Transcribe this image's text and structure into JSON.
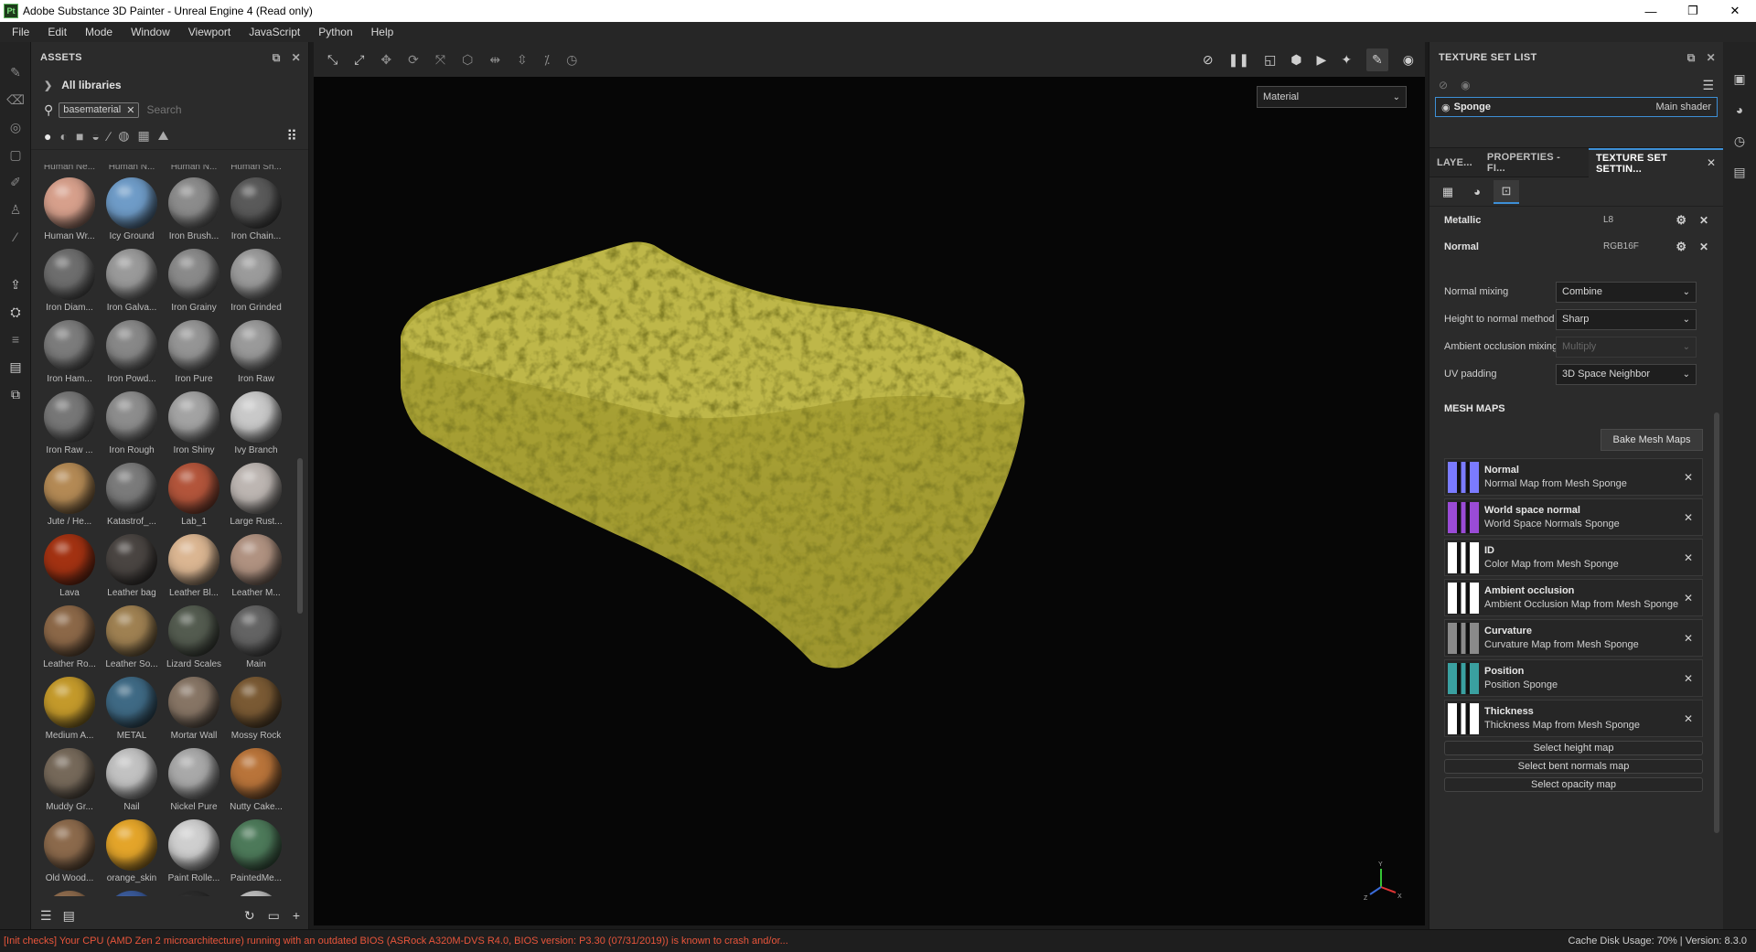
{
  "window": {
    "logo_text": "Pt",
    "title": "Adobe Substance 3D Painter - Unreal Engine 4 (Read only)",
    "minimize": "—",
    "maximize": "❐",
    "close": "✕"
  },
  "menu": [
    "File",
    "Edit",
    "Mode",
    "Window",
    "Viewport",
    "JavaScript",
    "Python",
    "Help"
  ],
  "assets": {
    "title": "ASSETS",
    "libraries_label": "All libraries",
    "search_tag": "basematerial",
    "search_placeholder": "Search",
    "cutoff_labels": [
      "Human Ne...",
      "Human N...",
      "Human N...",
      "Human Sh..."
    ],
    "materials": [
      {
        "label": "Human Wr...",
        "color": "#d7a08c"
      },
      {
        "label": "Icy Ground",
        "color": "#6f9cc8"
      },
      {
        "label": "Iron Brush...",
        "color": "#8c8c8c"
      },
      {
        "label": "Iron Chain...",
        "color": "#5a5a5a"
      },
      {
        "label": "Iron Diam...",
        "color": "#6e6e6e"
      },
      {
        "label": "Iron Galva...",
        "color": "#9a9a9a"
      },
      {
        "label": "Iron Grainy",
        "color": "#8a8a8a"
      },
      {
        "label": "Iron Grinded",
        "color": "#9b9b9b"
      },
      {
        "label": "Iron Ham...",
        "color": "#7c7c7c"
      },
      {
        "label": "Iron Powd...",
        "color": "#888888"
      },
      {
        "label": "Iron Pure",
        "color": "#959595"
      },
      {
        "label": "Iron Raw",
        "color": "#9a9a9a"
      },
      {
        "label": "Iron Raw ...",
        "color": "#777777"
      },
      {
        "label": "Iron Rough",
        "color": "#8d8d8d"
      },
      {
        "label": "Iron Shiny",
        "color": "#a3a3a3"
      },
      {
        "label": "Ivy Branch",
        "color": "#c9c9c9"
      },
      {
        "label": "Jute / He...",
        "color": "#b48a55"
      },
      {
        "label": "Katastrof_...",
        "color": "#7b7b7b"
      },
      {
        "label": "Lab_1",
        "color": "#b3553b"
      },
      {
        "label": "Large Rust...",
        "color": "#bdb6b2"
      },
      {
        "label": "Lava",
        "color": "#a33212"
      },
      {
        "label": "Leather bag",
        "color": "#4a4542"
      },
      {
        "label": "Leather Bl...",
        "color": "#dbb692"
      },
      {
        "label": "Leather M...",
        "color": "#b09281"
      },
      {
        "label": "Leather Ro...",
        "color": "#8c6848"
      },
      {
        "label": "Leather So...",
        "color": "#9f8152"
      },
      {
        "label": "Lizard Scales",
        "color": "#545c50"
      },
      {
        "label": "Main",
        "color": "#646464"
      },
      {
        "label": "Medium A...",
        "color": "#c49a2b"
      },
      {
        "label": "METAL",
        "color": "#3f6a85"
      },
      {
        "label": "Mortar Wall",
        "color": "#877565"
      },
      {
        "label": "Mossy Rock",
        "color": "#7a5a34"
      },
      {
        "label": "Muddy Gr...",
        "color": "#76695a"
      },
      {
        "label": "Nail",
        "color": "#c2c2c2"
      },
      {
        "label": "Nickel Pure",
        "color": "#a9a9a9"
      },
      {
        "label": "Nutty Cake...",
        "color": "#b9743a"
      },
      {
        "label": "Old Wood...",
        "color": "#8c6a4c"
      },
      {
        "label": "orange_skin",
        "color": "#e4a52a"
      },
      {
        "label": "Paint Rolle...",
        "color": "#cfcfcf"
      },
      {
        "label": "PaintedMe...",
        "color": "#4d7a5a"
      },
      {
        "label": "",
        "color": "#8c6a4c"
      },
      {
        "label": "",
        "color": "#3a5a9a"
      },
      {
        "label": "",
        "color": "#2b2b2b"
      },
      {
        "label": "",
        "color": "#bdbdbd"
      }
    ]
  },
  "viewport": {
    "mode_select": "Material",
    "axis_x": "X",
    "axis_y": "Y",
    "axis_z": "Z"
  },
  "texture_set_list": {
    "title": "TEXTURE SET LIST",
    "set_name": "Sponge",
    "shader": "Main shader"
  },
  "tabs": [
    {
      "label": "LAYE...",
      "active": false
    },
    {
      "label": "PROPERTIES - FI...",
      "active": false
    },
    {
      "label": "TEXTURE SET SETTIN...",
      "active": true
    }
  ],
  "channels": [
    {
      "name": "Metallic",
      "format": "L8"
    },
    {
      "name": "Normal",
      "format": "RGB16F"
    }
  ],
  "properties": [
    {
      "label": "Normal mixing",
      "value": "Combine",
      "disabled": false
    },
    {
      "label": "Height to normal method",
      "value": "Sharp",
      "disabled": false
    },
    {
      "label": "Ambient occlusion mixing",
      "value": "Multiply",
      "disabled": true
    },
    {
      "label": "UV padding",
      "value": "3D Space Neighbor",
      "disabled": false
    }
  ],
  "mesh_maps": {
    "title": "MESH MAPS",
    "bake_button": "Bake Mesh Maps",
    "maps": [
      {
        "name": "Normal",
        "sub": "Normal Map from Mesh Sponge",
        "color": "#7b7bff"
      },
      {
        "name": "World space normal",
        "sub": "World Space Normals Sponge",
        "color": "#9a4bd6"
      },
      {
        "name": "ID",
        "sub": "Color Map from Mesh Sponge",
        "color": "#ffffff"
      },
      {
        "name": "Ambient occlusion",
        "sub": "Ambient Occlusion Map from Mesh Sponge",
        "color": "#ffffff"
      },
      {
        "name": "Curvature",
        "sub": "Curvature Map from Mesh Sponge",
        "color": "#8a8a8a"
      },
      {
        "name": "Position",
        "sub": "Position Sponge",
        "color": "#3aa0a0"
      },
      {
        "name": "Thickness",
        "sub": "Thickness Map from Mesh Sponge",
        "color": "#ffffff"
      }
    ],
    "select_buttons": [
      "Select height map",
      "Select bent normals map",
      "Select opacity map"
    ]
  },
  "status": {
    "error": "[Init checks] Your CPU (AMD Zen 2 microarchitecture) running with an outdated BIOS (ASRock A320M-DVS R4.0, BIOS version: P3.30 (07/31/2019)) is known to crash and/or...",
    "info": "Cache Disk Usage:  70% | Version: 8.3.0"
  }
}
